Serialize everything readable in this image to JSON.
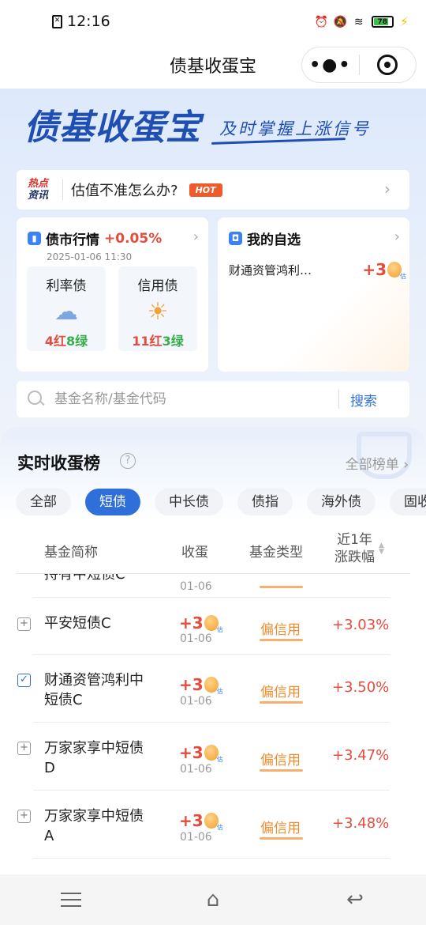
{
  "status_bar": {
    "time": "12:16",
    "battery": "78"
  },
  "app": {
    "title": "债基收蛋宝"
  },
  "hero": {
    "brand": "债基收蛋宝",
    "slogan": "及时掌握上涨信号"
  },
  "news": {
    "tag_line1": "热点",
    "tag_line2": "资讯",
    "text": "估值不准怎么办?",
    "badge": "HOT"
  },
  "market": {
    "title": "债市行情",
    "change": "+0.05%",
    "time": "2025-01-06 11:30",
    "cards": [
      {
        "title": "利率债",
        "weather": "rain",
        "red": "4红",
        "green": "8绿"
      },
      {
        "title": "信用债",
        "weather": "sun",
        "red": "11红",
        "green": "3绿"
      }
    ]
  },
  "favorites": {
    "title": "我的自选",
    "item_name": "财通资管鸿利…",
    "item_value": "+3"
  },
  "search": {
    "placeholder": "基金名称/基金代码",
    "button": "搜索"
  },
  "ranking": {
    "title": "实时收蛋榜",
    "all_label": "全部榜单",
    "filters": [
      "全部",
      "短债",
      "中长债",
      "债指",
      "海外债",
      "固收"
    ],
    "active_filter": 1,
    "headers": {
      "name": "基金简称",
      "egg": "收蛋",
      "type": "基金类型",
      "rate_line1": "近1年",
      "rate_line2": "涨跌幅"
    },
    "partial_row": {
      "name": "持有中短债C",
      "date": "01-06"
    },
    "rows": [
      {
        "name": "平安短债C",
        "egg": "+3",
        "date": "01-06",
        "type": "偏信用",
        "rate": "+3.03%",
        "checked": false
      },
      {
        "name": "财通资管鸿利中短债C",
        "egg": "+3",
        "date": "01-06",
        "type": "偏信用",
        "rate": "+3.50%",
        "checked": true
      },
      {
        "name": "万家家享中短债D",
        "egg": "+3",
        "date": "01-06",
        "type": "偏信用",
        "rate": "+3.47%",
        "checked": false
      },
      {
        "name": "万家家享中短债A",
        "egg": "+3",
        "date": "01-06",
        "type": "偏信用",
        "rate": "+3.48%",
        "checked": false
      }
    ]
  }
}
